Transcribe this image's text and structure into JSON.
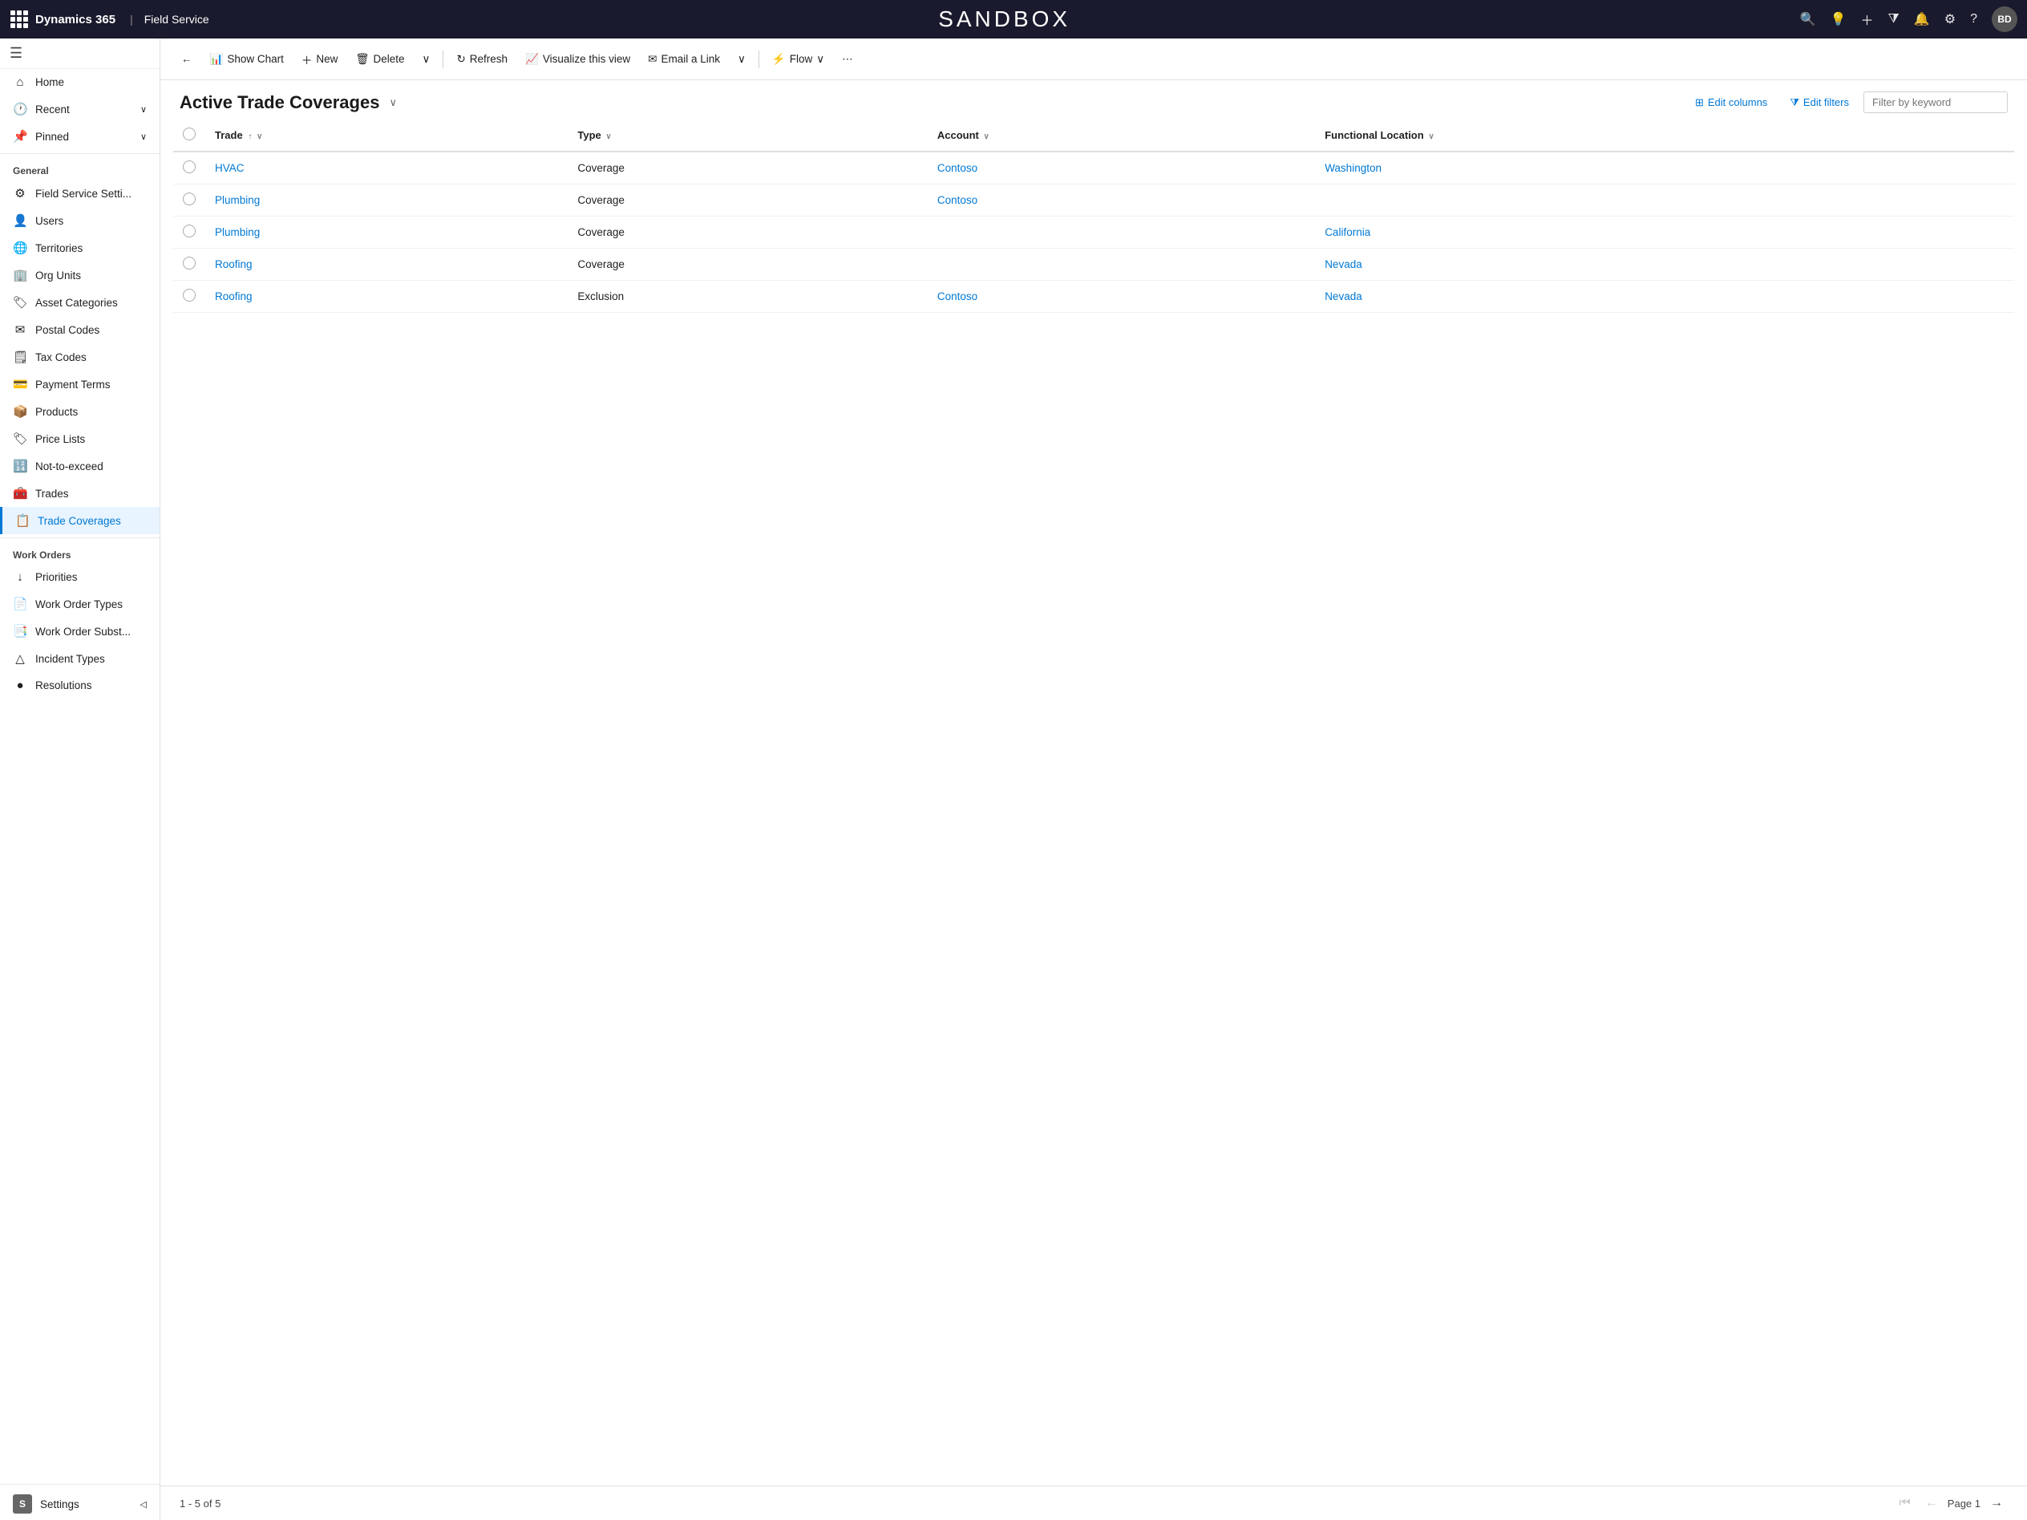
{
  "topbar": {
    "brand": "Dynamics 365",
    "separator": "|",
    "module": "Field Service",
    "title": "SANDBOX",
    "avatar": "BD"
  },
  "sidebar": {
    "hamburger": "☰",
    "nav_top": [
      {
        "id": "home",
        "label": "Home",
        "icon": "⌂"
      },
      {
        "id": "recent",
        "label": "Recent",
        "icon": "🕐",
        "chevron": "∨"
      },
      {
        "id": "pinned",
        "label": "Pinned",
        "icon": "📌",
        "chevron": "∨"
      }
    ],
    "general_header": "General",
    "general_items": [
      {
        "id": "field-service-settings",
        "label": "Field Service Setti...",
        "icon": "⚙"
      },
      {
        "id": "users",
        "label": "Users",
        "icon": "👤"
      },
      {
        "id": "territories",
        "label": "Territories",
        "icon": "🌐"
      },
      {
        "id": "org-units",
        "label": "Org Units",
        "icon": "🏢"
      },
      {
        "id": "asset-categories",
        "label": "Asset Categories",
        "icon": "🏷"
      },
      {
        "id": "postal-codes",
        "label": "Postal Codes",
        "icon": "✉"
      },
      {
        "id": "tax-codes",
        "label": "Tax Codes",
        "icon": "🗒"
      },
      {
        "id": "payment-terms",
        "label": "Payment Terms",
        "icon": "💳"
      },
      {
        "id": "products",
        "label": "Products",
        "icon": "📦"
      },
      {
        "id": "price-lists",
        "label": "Price Lists",
        "icon": "🏷"
      },
      {
        "id": "not-to-exceed",
        "label": "Not-to-exceed",
        "icon": "🔢"
      },
      {
        "id": "trades",
        "label": "Trades",
        "icon": "🧰"
      },
      {
        "id": "trade-coverages",
        "label": "Trade Coverages",
        "icon": "📋",
        "active": true
      }
    ],
    "work_orders_header": "Work Orders",
    "work_orders_items": [
      {
        "id": "priorities",
        "label": "Priorities",
        "icon": "↓"
      },
      {
        "id": "work-order-types",
        "label": "Work Order Types",
        "icon": "📄"
      },
      {
        "id": "work-order-subst",
        "label": "Work Order Subst...",
        "icon": "📑"
      },
      {
        "id": "incident-types",
        "label": "Incident Types",
        "icon": "△"
      },
      {
        "id": "resolutions",
        "label": "Resolutions",
        "icon": "🔵"
      }
    ],
    "settings_label": "Settings",
    "settings_icon": "S"
  },
  "command_bar": {
    "back_icon": "←",
    "show_chart": "Show Chart",
    "new": "New",
    "delete": "Delete",
    "refresh": "Refresh",
    "visualize": "Visualize this view",
    "email_link": "Email a Link",
    "flow": "Flow",
    "more": "⋯"
  },
  "list_header": {
    "title": "Active Trade Coverages",
    "chevron": "∨",
    "edit_columns": "Edit columns",
    "edit_filters": "Edit filters",
    "filter_placeholder": "Filter by keyword"
  },
  "table": {
    "columns": [
      {
        "id": "trade",
        "label": "Trade",
        "sort": "↑",
        "has_chevron": true
      },
      {
        "id": "type",
        "label": "Type",
        "has_chevron": true
      },
      {
        "id": "account",
        "label": "Account",
        "has_chevron": true
      },
      {
        "id": "functional_location",
        "label": "Functional Location",
        "has_chevron": true
      }
    ],
    "rows": [
      {
        "trade": "HVAC",
        "type": "Coverage",
        "account": "Contoso",
        "functional_location": "Washington"
      },
      {
        "trade": "Plumbing",
        "type": "Coverage",
        "account": "Contoso",
        "functional_location": ""
      },
      {
        "trade": "Plumbing",
        "type": "Coverage",
        "account": "",
        "functional_location": "California"
      },
      {
        "trade": "Roofing",
        "type": "Coverage",
        "account": "",
        "functional_location": "Nevada"
      },
      {
        "trade": "Roofing",
        "type": "Exclusion",
        "account": "Contoso",
        "functional_location": "Nevada"
      }
    ]
  },
  "footer": {
    "range": "1 - 5 of 5",
    "page_label": "Page 1"
  }
}
